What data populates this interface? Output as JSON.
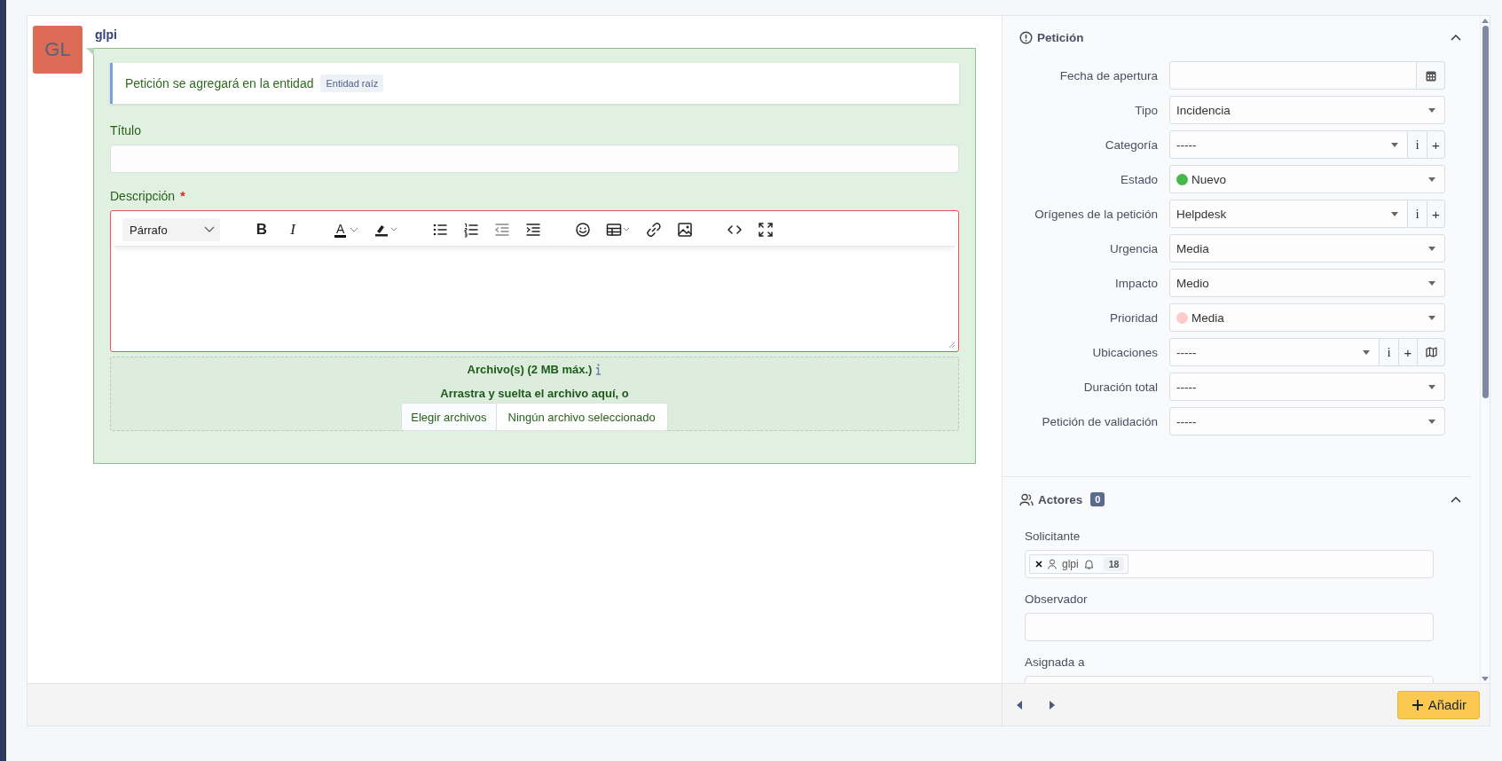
{
  "author": {
    "initials": "GL",
    "name": "glpi"
  },
  "entity_notice": {
    "text": "Petición se agregará en la entidad",
    "badge": "Entidad raíz"
  },
  "title_field": {
    "label": "Título"
  },
  "description": {
    "label": "Descripción",
    "required_mark": "*",
    "toolbar": [
      [
        {
          "kind": "format",
          "label": "Párrafo"
        }
      ],
      [
        {
          "kind": "bold",
          "label": "B"
        },
        {
          "kind": "italic",
          "label": "I"
        }
      ],
      [
        {
          "kind": "text-color",
          "label": "A"
        },
        {
          "kind": "highlight"
        }
      ],
      [
        {
          "kind": "bullet-list"
        },
        {
          "kind": "numbered-list"
        },
        {
          "kind": "outdent"
        },
        {
          "kind": "indent"
        }
      ],
      [
        {
          "kind": "emoji"
        },
        {
          "kind": "table"
        },
        {
          "kind": "link"
        },
        {
          "kind": "image"
        }
      ],
      [
        {
          "kind": "code"
        },
        {
          "kind": "fullscreen"
        }
      ]
    ]
  },
  "attachments": {
    "title": "Archivo(s) (2 MB máx.)",
    "hint": "Arrastra y suelta el archivo aquí, o",
    "button": "Elegir archivos",
    "status": "Ningún archivo seleccionado"
  },
  "ticket_section": {
    "title": "Petición",
    "expanded": true,
    "rows": [
      {
        "label": "Fecha de apertura",
        "kind": "date"
      },
      {
        "label": "Tipo",
        "kind": "select",
        "value": "Incidencia"
      },
      {
        "label": "Categoría",
        "kind": "select",
        "value": "-----",
        "actions": [
          "i",
          "+"
        ]
      },
      {
        "label": "Estado",
        "kind": "select",
        "value": "Nuevo",
        "color": "#45b94b"
      },
      {
        "label": "Orígenes de la petición",
        "kind": "select",
        "value": "Helpdesk",
        "actions": [
          "i",
          "+"
        ]
      },
      {
        "label": "Urgencia",
        "kind": "select",
        "value": "Media"
      },
      {
        "label": "Impacto",
        "kind": "select",
        "value": "Medio"
      },
      {
        "label": "Prioridad",
        "kind": "select",
        "value": "Media",
        "color": "#ffcaca"
      },
      {
        "label": "Ubicaciones",
        "kind": "select",
        "value": "-----",
        "actions": [
          "i",
          "+"
        ],
        "map_button": true
      },
      {
        "label": "Duración total",
        "kind": "select",
        "value": "-----"
      },
      {
        "label": "Petición de validación",
        "kind": "select",
        "value": "-----"
      }
    ]
  },
  "actors_section": {
    "title": "Actores",
    "count": "0",
    "expanded": true,
    "groups": [
      {
        "label": "Solicitante",
        "tags": [
          {
            "name": "glpi",
            "count": "18"
          }
        ]
      },
      {
        "label": "Observador"
      },
      {
        "label": "Asignada a"
      }
    ]
  },
  "footer": {
    "button": "Añadir"
  }
}
